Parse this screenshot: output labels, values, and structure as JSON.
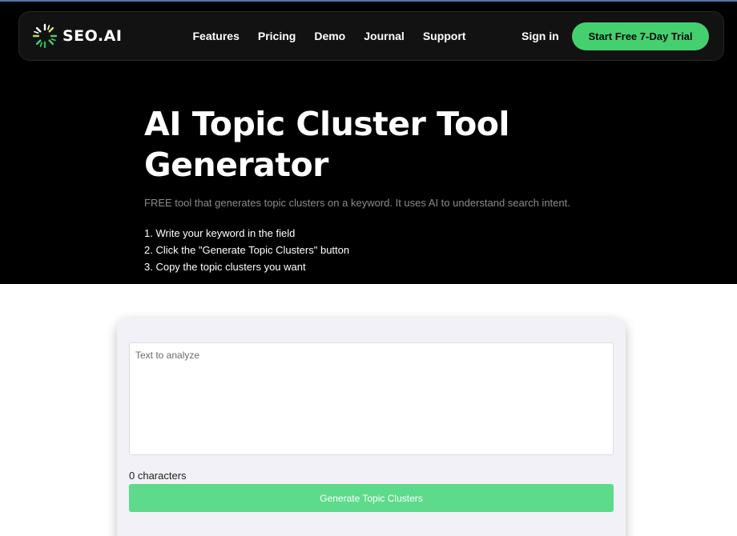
{
  "brand": {
    "name": "SEO.AI",
    "accent": "#45d06f"
  },
  "nav": {
    "links": [
      "Features",
      "Pricing",
      "Demo",
      "Journal",
      "Support"
    ],
    "sign_in": "Sign in",
    "cta": "Start Free 7-Day Trial"
  },
  "hero": {
    "title": "AI Topic Cluster Tool Generator",
    "subtitle": "FREE tool that generates topic clusters on a keyword. It uses AI to understand search intent.",
    "steps": [
      "1. Write your keyword in the field",
      "2. Click the \"Generate Topic Clusters\" button",
      "3. Copy the topic clusters you want"
    ]
  },
  "tool": {
    "input_placeholder": "Text to analyze",
    "input_value": "",
    "char_count": "0 characters",
    "generate_label": "Generate Topic Clusters"
  }
}
